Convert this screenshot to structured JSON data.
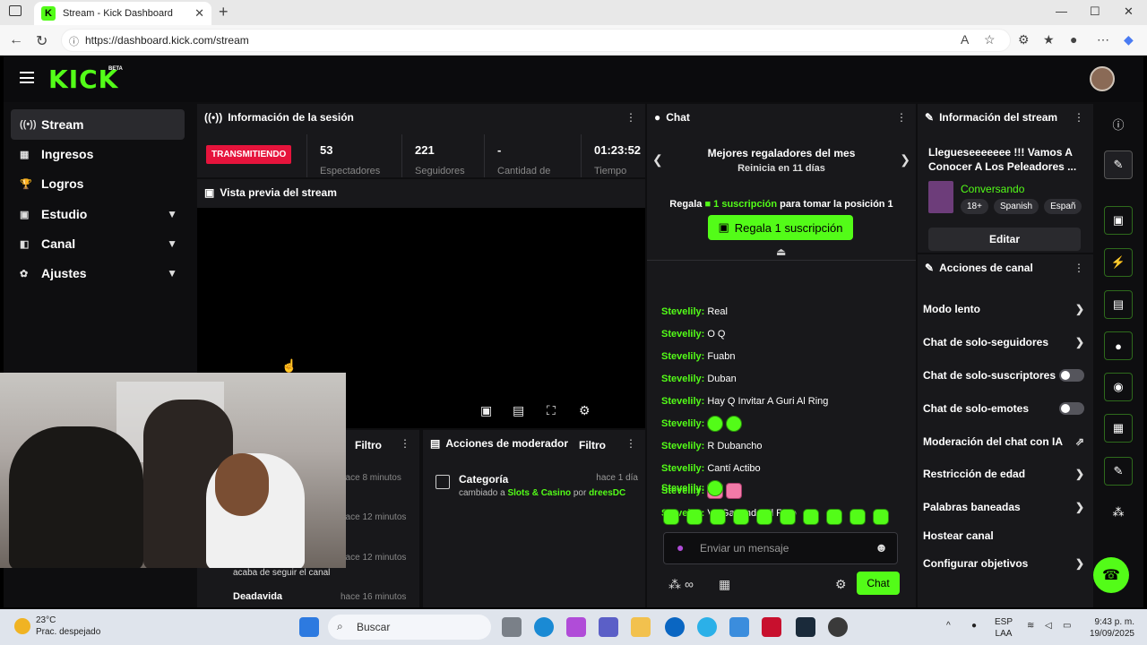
{
  "browser": {
    "tab_title": "Stream - Kick Dashboard",
    "tab_favicon_letter": "K",
    "url": "https://dashboard.kick.com/stream"
  },
  "app": {
    "logo": "KICK",
    "logo_badge": "BETA"
  },
  "sidebar": {
    "items": [
      {
        "label": "Stream",
        "icon": "broadcast-icon",
        "active": true
      },
      {
        "label": "Ingresos",
        "icon": "chart-icon"
      },
      {
        "label": "Logros",
        "icon": "trophy-icon"
      },
      {
        "label": "Estudio",
        "icon": "studio-icon",
        "expandable": true
      },
      {
        "label": "Canal",
        "icon": "channel-icon",
        "expandable": true
      },
      {
        "label": "Ajustes",
        "icon": "gear-icon",
        "expandable": true
      }
    ]
  },
  "session": {
    "title": "Información de la sesión",
    "live_badge": "TRANSMITIENDO",
    "stats": [
      {
        "value": "53",
        "label": "Espectadores"
      },
      {
        "value": "221",
        "label": "Seguidores"
      },
      {
        "value": "-",
        "label": "Cantidad de"
      },
      {
        "value": "01:23:52",
        "label": "Tiempo"
      }
    ]
  },
  "preview": {
    "title": "Vista previa del stream"
  },
  "activity": {
    "filter_label": "Filtro",
    "rows": [
      {
        "time": "hace 8 minutos"
      },
      {
        "time": "hace 12 minutos"
      },
      {
        "time": "hace 12 minutos"
      },
      {
        "time": "hace 16 minutos"
      }
    ],
    "partial_text": "acaba de seguir el canal",
    "partial_user": "Deadavida"
  },
  "mod_actions": {
    "title": "Acciones de moderador",
    "filter_label": "Filtro",
    "entry": {
      "title": "Categoría",
      "time": "hace 1 día",
      "desc_prefix": "cambiado a",
      "category": "Slots & Casino",
      "desc_by": "por",
      "user": "dreesDC"
    }
  },
  "chat": {
    "title": "Chat",
    "leaderboard_title": "Mejores regaladores del mes",
    "leaderboard_sub": "Reinicia en 11 días",
    "gift_prefix": "Regala",
    "gift_highlight": "1 suscripción",
    "gift_suffix": "para tomar la posición 1",
    "gift_button": "Regala 1 suscripción",
    "messages": [
      {
        "user": "Stevelily:",
        "text": "Real"
      },
      {
        "user": "Stevelily:",
        "text": "O Q"
      },
      {
        "user": "Stevelily:",
        "text": "Fuabn"
      },
      {
        "user": "Stevelily:",
        "text": "Duban"
      },
      {
        "user": "Stevelily:",
        "text": "Hay Q Invitar A Guri Al Ring"
      },
      {
        "user": "Stevelily:",
        "text": "",
        "emotes": [
          "green",
          "green"
        ]
      },
      {
        "user": "Stevelily:",
        "text": "R Dubancho"
      },
      {
        "user": "Stevelily:",
        "text": "Cantí Actibo"
      },
      {
        "user": "Stevelily:",
        "text": "",
        "emotes": [
          "pink",
          "pink"
        ]
      },
      {
        "user": "Stevelily:",
        "text": "Va Ganando El Rojo"
      },
      {
        "user": "Stevelily:",
        "text": "",
        "emotes": [
          "green"
        ]
      }
    ],
    "input_placeholder": "Enviar un mensaje",
    "send_label": "Chat",
    "footer_badge": "∞"
  },
  "stream_info": {
    "title": "Información del stream",
    "stream_title": "Llegueseeeeeee !!! Vamos A Conocer A Los Peleadores ...",
    "category": "Conversando",
    "tags": [
      "18+",
      "Spanish",
      "Españ"
    ],
    "edit_label": "Editar"
  },
  "channel_actions": {
    "title": "Acciones de canal",
    "items": [
      {
        "label": "Modo lento",
        "control": "arrow"
      },
      {
        "label": "Chat de solo-seguidores",
        "control": "arrow"
      },
      {
        "label": "Chat de solo-suscriptores",
        "control": "toggle"
      },
      {
        "label": "Chat de solo-emotes",
        "control": "toggle"
      },
      {
        "label": "Moderación del chat con IA",
        "control": "external"
      },
      {
        "label": "Restricción de edad",
        "control": "arrow"
      },
      {
        "label": "Palabras baneadas",
        "control": "arrow"
      },
      {
        "label": "Hostear canal",
        "control": "none"
      },
      {
        "label": "Configurar objetivos",
        "control": "arrow"
      }
    ]
  },
  "taskbar": {
    "weather_temp": "23°C",
    "weather_desc": "Prac. despejado",
    "search_placeholder": "Buscar",
    "lang_top": "ESP",
    "lang_bottom": "LAA",
    "time": "9:43 p. m.",
    "date": "19/09/2025"
  },
  "colors": {
    "brand": "#53fc18",
    "live": "#e6143c",
    "panel": "#18181b",
    "background": "#0e0e10"
  }
}
